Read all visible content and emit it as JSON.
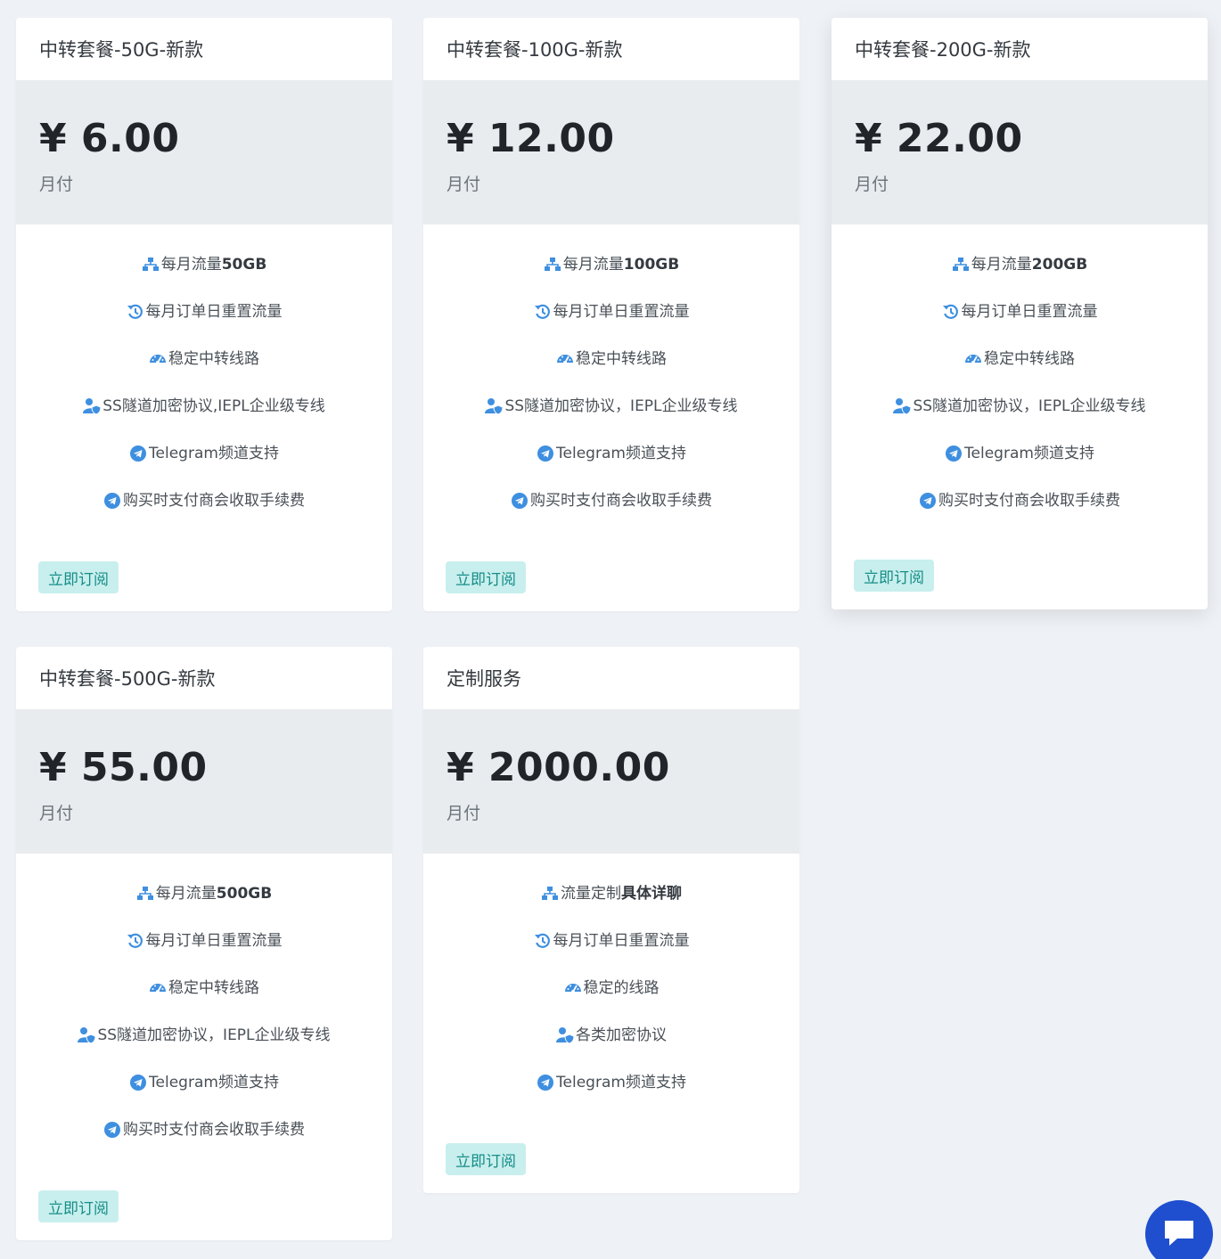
{
  "icons": {
    "traffic": "network-icon",
    "reset": "history-icon",
    "speed": "speedometer-icon",
    "protocol": "user-shield-icon",
    "telegram": "telegram-icon",
    "fee": "telegram-icon"
  },
  "colors": {
    "icon": "#3e8fe0",
    "button_bg": "#c8efee",
    "button_text": "#168d86",
    "chat": "#1f4fcf"
  },
  "plans": [
    {
      "title": "中转套餐-50G-新款",
      "price": "¥ 6.00",
      "period": "月付",
      "features": [
        {
          "icon": "network-icon",
          "text": "每月流量",
          "bold": "50GB"
        },
        {
          "icon": "history-icon",
          "text": "每月订单日重置流量",
          "bold": ""
        },
        {
          "icon": "speedometer-icon",
          "text": "稳定中转线路",
          "bold": ""
        },
        {
          "icon": "user-shield-icon",
          "text": "SS隧道加密协议,IEPL企业级专线",
          "bold": ""
        },
        {
          "icon": "telegram-icon",
          "text": "Telegram频道支持",
          "bold": ""
        },
        {
          "icon": "telegram-icon",
          "text": "购买时支付商会收取手续费",
          "bold": ""
        }
      ],
      "button": "立即订阅"
    },
    {
      "title": "中转套餐-100G-新款",
      "price": "¥ 12.00",
      "period": "月付",
      "features": [
        {
          "icon": "network-icon",
          "text": "每月流量",
          "bold": "100GB"
        },
        {
          "icon": "history-icon",
          "text": "每月订单日重置流量",
          "bold": ""
        },
        {
          "icon": "speedometer-icon",
          "text": "稳定中转线路",
          "bold": ""
        },
        {
          "icon": "user-shield-icon",
          "text": "SS隧道加密协议，IEPL企业级专线",
          "bold": ""
        },
        {
          "icon": "telegram-icon",
          "text": "Telegram频道支持",
          "bold": ""
        },
        {
          "icon": "telegram-icon",
          "text": "购买时支付商会收取手续费",
          "bold": ""
        }
      ],
      "button": "立即订阅"
    },
    {
      "title": "中转套餐-200G-新款",
      "price": "¥ 22.00",
      "period": "月付",
      "features": [
        {
          "icon": "network-icon",
          "text": "每月流量",
          "bold": "200GB"
        },
        {
          "icon": "history-icon",
          "text": "每月订单日重置流量",
          "bold": ""
        },
        {
          "icon": "speedometer-icon",
          "text": "稳定中转线路",
          "bold": ""
        },
        {
          "icon": "user-shield-icon",
          "text": "SS隧道加密协议，IEPL企业级专线",
          "bold": ""
        },
        {
          "icon": "telegram-icon",
          "text": "Telegram频道支持",
          "bold": ""
        },
        {
          "icon": "telegram-icon",
          "text": "购买时支付商会收取手续费",
          "bold": ""
        }
      ],
      "button": "立即订阅"
    },
    {
      "title": "中转套餐-500G-新款",
      "price": "¥ 55.00",
      "period": "月付",
      "features": [
        {
          "icon": "network-icon",
          "text": "每月流量",
          "bold": "500GB"
        },
        {
          "icon": "history-icon",
          "text": "每月订单日重置流量",
          "bold": ""
        },
        {
          "icon": "speedometer-icon",
          "text": "稳定中转线路",
          "bold": ""
        },
        {
          "icon": "user-shield-icon",
          "text": "SS隧道加密协议，IEPL企业级专线",
          "bold": ""
        },
        {
          "icon": "telegram-icon",
          "text": "Telegram频道支持",
          "bold": ""
        },
        {
          "icon": "telegram-icon",
          "text": "购买时支付商会收取手续费",
          "bold": ""
        }
      ],
      "button": "立即订阅"
    },
    {
      "title": "定制服务",
      "price": "¥ 2000.00",
      "period": "月付",
      "features": [
        {
          "icon": "network-icon",
          "text": "流量定制",
          "bold": "具体详聊"
        },
        {
          "icon": "history-icon",
          "text": "每月订单日重置流量",
          "bold": ""
        },
        {
          "icon": "speedometer-icon",
          "text": "稳定的线路",
          "bold": ""
        },
        {
          "icon": "user-shield-icon",
          "text": "各类加密协议",
          "bold": ""
        },
        {
          "icon": "telegram-icon",
          "text": "Telegram频道支持",
          "bold": ""
        }
      ],
      "button": "立即订阅"
    }
  ],
  "chat": {
    "icon": "chat-bubble-icon"
  }
}
